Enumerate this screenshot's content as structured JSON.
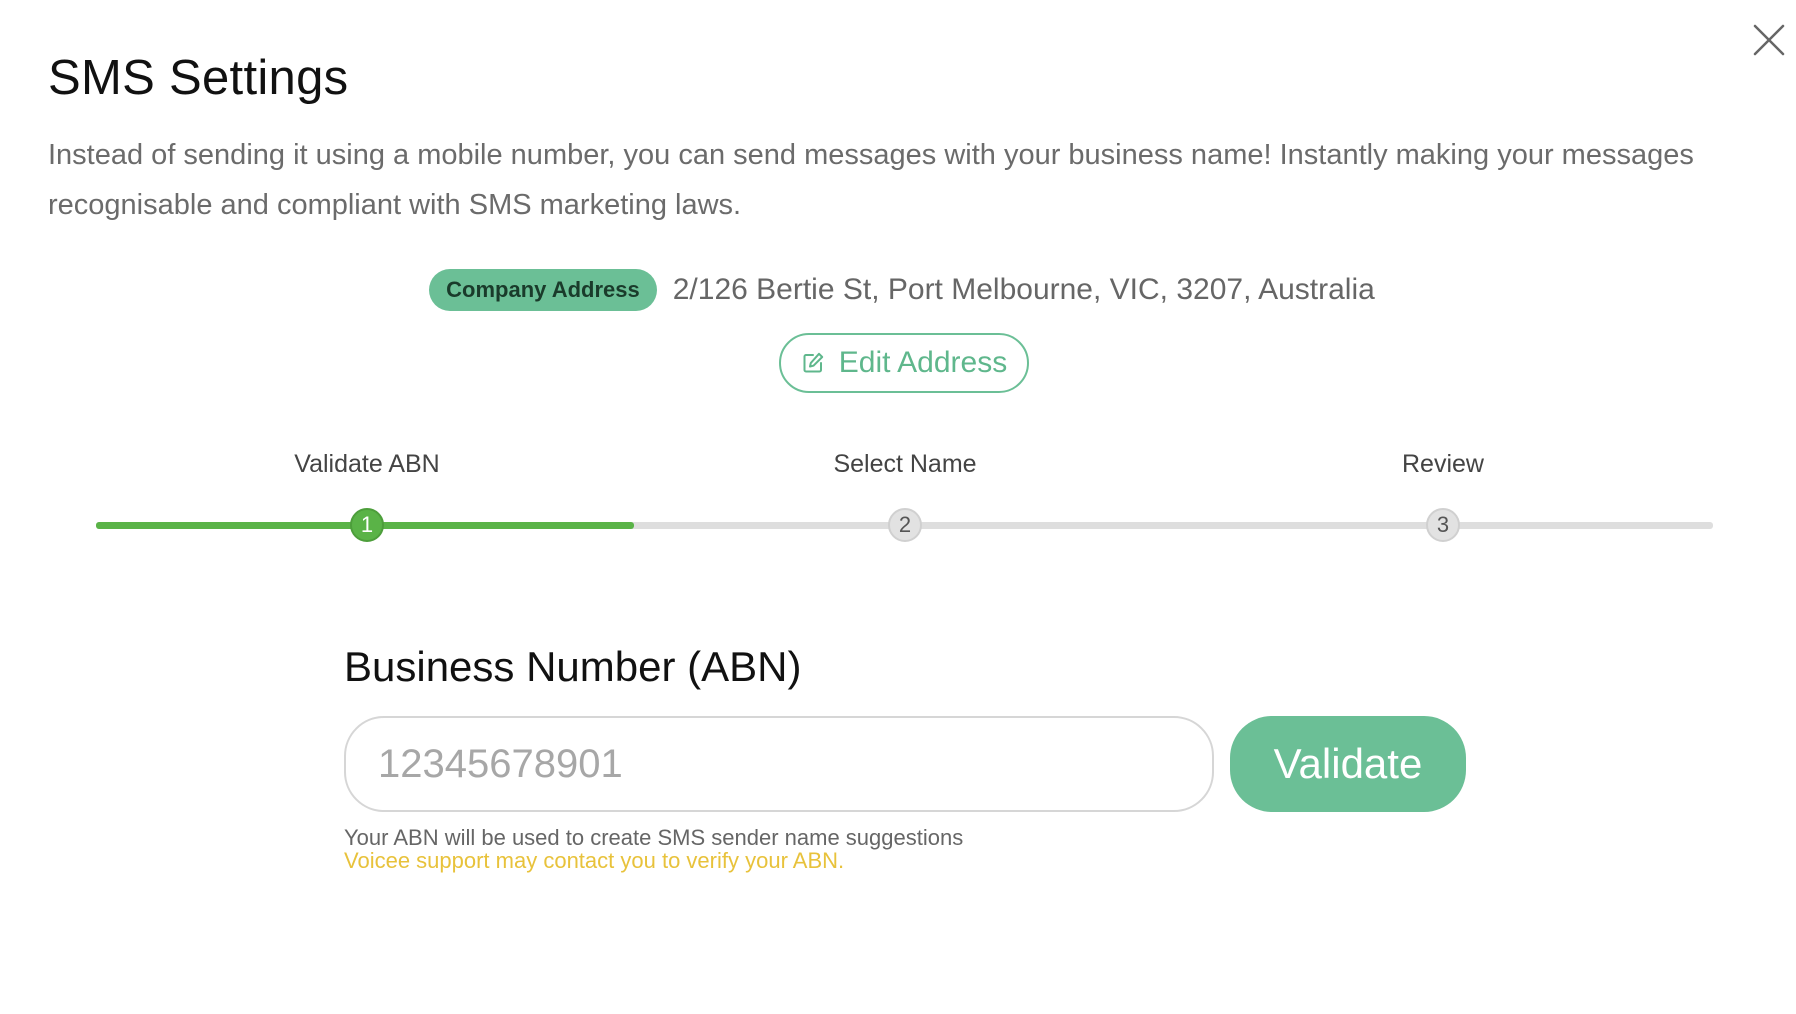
{
  "dialog": {
    "title": "SMS Settings",
    "description": "Instead of sending it using a mobile number, you can send messages with your business name! Instantly making your messages recognisable and compliant with SMS marketing laws.",
    "close_icon": "close-icon"
  },
  "address": {
    "badge": "Company Address",
    "value": "2/126 Bertie St, Port Melbourne, VIC, 3207, Australia",
    "edit_label": "Edit Address",
    "edit_icon": "edit-icon"
  },
  "stepper": {
    "progress": 0.333,
    "steps": [
      {
        "label": "Validate ABN",
        "number": "1",
        "state": "active"
      },
      {
        "label": "Select Name",
        "number": "2",
        "state": "inactive"
      },
      {
        "label": "Review",
        "number": "3",
        "state": "inactive"
      }
    ]
  },
  "abn": {
    "title": "Business Number (ABN)",
    "value": "",
    "placeholder": "12345678901",
    "validate_label": "Validate",
    "help_text": "Your ABN will be used to create SMS sender name suggestions",
    "warning_text": "Voicee support may contact you to verify your ABN."
  },
  "colors": {
    "accent": "#6bbf96",
    "step_active": "#5ab347",
    "warning": "#e8c23b"
  }
}
